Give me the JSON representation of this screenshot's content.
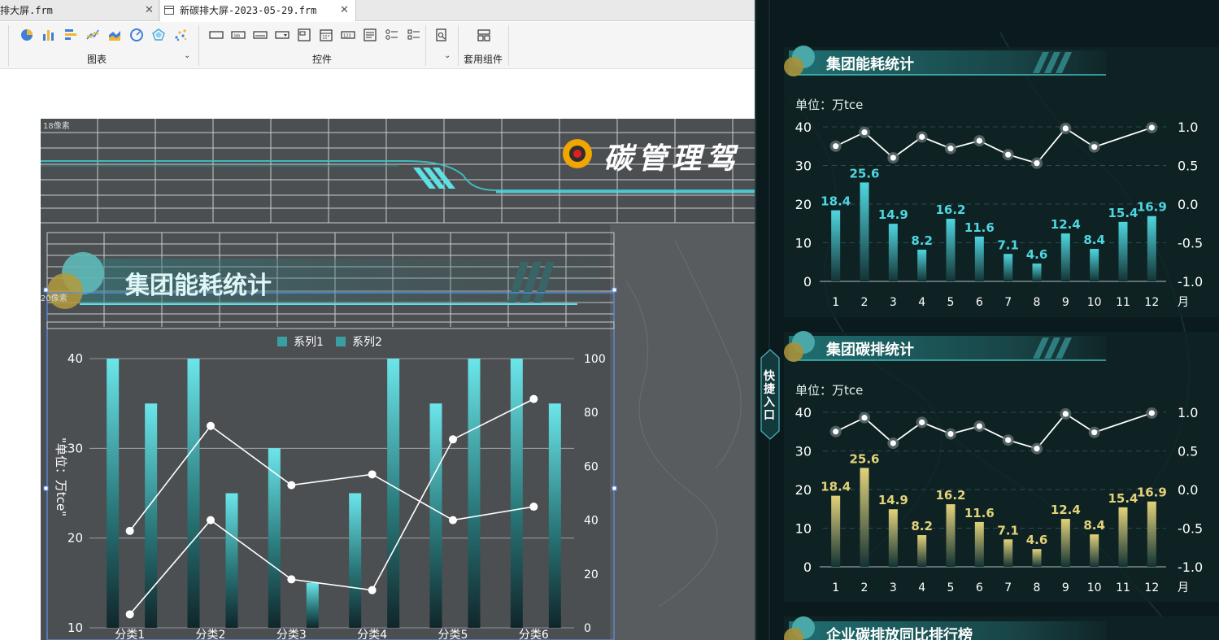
{
  "tabs": [
    {
      "label": "排大屏.frm",
      "active": false
    },
    {
      "label": "新碳排大屏-2023-05-29.frm",
      "active": true
    }
  ],
  "ribbon": {
    "groups": [
      "图表",
      "控件",
      "套用组件"
    ],
    "chart_icons": [
      "pie-chart-icon",
      "bar-chart-icon",
      "horizontal-bar-icon",
      "line-chart-icon",
      "area-chart-icon",
      "gauge-chart-icon",
      "radar-chart-icon",
      "scatter-chart-icon"
    ],
    "control_icons": [
      "button-widget-icon",
      "label-widget-icon",
      "textbox-widget-icon",
      "combobox-widget-icon",
      "frame-widget-icon",
      "date-widget-icon",
      "number-widget-icon",
      "textarea-widget-icon",
      "radio-widget-icon",
      "checkbox-widget-icon",
      "search-widget-icon"
    ],
    "component_icon": "layout-component-icon"
  },
  "designer": {
    "pixel_label_1": "18像素",
    "pixel_label_2": "20像素",
    "banner_title": "碳管理驾",
    "block_title": "集团能耗统计",
    "accent": "#4fd6d6"
  },
  "designer_chart": {
    "legend": [
      "系列1",
      "系列2"
    ],
    "ylabel": "\"单位：万tce\"",
    "left_ticks": [
      "40",
      "30",
      "20",
      "10"
    ],
    "right_ticks": [
      "100",
      "80",
      "60",
      "40",
      "20",
      "0"
    ],
    "categories": [
      "分类1",
      "分类2",
      "分类3",
      "分类4",
      "分类5",
      "分类6"
    ]
  },
  "right_panel": {
    "quick_entry": "快捷入口",
    "panel1_title": "集团能耗统计",
    "panel2_title": "集团碳排统计",
    "panel3_title": "企业碳排放同比排行榜",
    "unit": "单位：万tce",
    "month_unit": "月",
    "bar_color_1": "#4fd6e0",
    "bar_color_2": "#e3d27a"
  },
  "chart_data": [
    {
      "type": "bar",
      "name": "designer-preview",
      "categories": [
        "分类1",
        "分类2",
        "分类3",
        "分类4",
        "分类5",
        "分类6"
      ],
      "series": [
        {
          "name": "系列1",
          "kind": "bar",
          "axis": "left",
          "values": [
            40,
            40,
            30,
            25,
            35,
            40
          ]
        },
        {
          "name": "系列2",
          "kind": "bar",
          "axis": "left",
          "values": [
            35,
            25,
            15,
            40,
            40,
            35
          ]
        },
        {
          "kind": "line",
          "axis": "right",
          "values": [
            36,
            75,
            53,
            57,
            40,
            45
          ]
        },
        {
          "kind": "line",
          "axis": "right",
          "values": [
            5,
            40,
            18,
            14,
            70,
            85
          ]
        }
      ],
      "ylim_left": [
        10,
        40
      ],
      "ylim_right": [
        0,
        100
      ],
      "ylabel": "\"单位：万tce\"",
      "legend_placement": "top-center"
    },
    {
      "type": "bar",
      "title": "集团能耗统计",
      "ylabel": "单位：万tce",
      "categories": [
        "1",
        "2",
        "3",
        "4",
        "5",
        "6",
        "7",
        "8",
        "9",
        "10",
        "11",
        "12"
      ],
      "xunit": "月",
      "series": [
        {
          "kind": "bar",
          "axis": "left",
          "values": [
            18.4,
            25.6,
            14.9,
            8.2,
            16.2,
            11.6,
            7.1,
            4.6,
            12.4,
            8.4,
            15.4,
            16.9
          ]
        },
        {
          "kind": "line",
          "axis": "right",
          "values": [
            0.75,
            0.93,
            0.6,
            0.87,
            0.72,
            0.82,
            0.64,
            0.53,
            0.98,
            0.74,
            0.99
          ]
        }
      ],
      "left_ticks": [
        "40",
        "30",
        "20",
        "10",
        "0"
      ],
      "right_ticks": [
        "1.0",
        "0.5",
        "0.0",
        "-0.5",
        "-1.0"
      ],
      "ylim_left": [
        0,
        40
      ],
      "ylim_right": [
        -1.0,
        1.0
      ],
      "grid": true
    },
    {
      "type": "bar",
      "title": "集团碳排统计",
      "ylabel": "单位：万tce",
      "categories": [
        "1",
        "2",
        "3",
        "4",
        "5",
        "6",
        "7",
        "8",
        "9",
        "10",
        "11",
        "12"
      ],
      "xunit": "月",
      "series": [
        {
          "kind": "bar",
          "axis": "left",
          "values": [
            18.4,
            25.6,
            14.9,
            8.2,
            16.2,
            11.6,
            7.1,
            4.6,
            12.4,
            8.4,
            15.4,
            16.9
          ]
        },
        {
          "kind": "line",
          "axis": "right",
          "values": [
            0.75,
            0.93,
            0.6,
            0.87,
            0.72,
            0.82,
            0.64,
            0.53,
            0.98,
            0.74,
            0.99
          ]
        }
      ],
      "left_ticks": [
        "40",
        "30",
        "20",
        "10",
        "0"
      ],
      "right_ticks": [
        "1.0",
        "0.5",
        "0.0",
        "-0.5",
        "-1.0"
      ],
      "ylim_left": [
        0,
        40
      ],
      "ylim_right": [
        -1.0,
        1.0
      ],
      "grid": true
    }
  ]
}
